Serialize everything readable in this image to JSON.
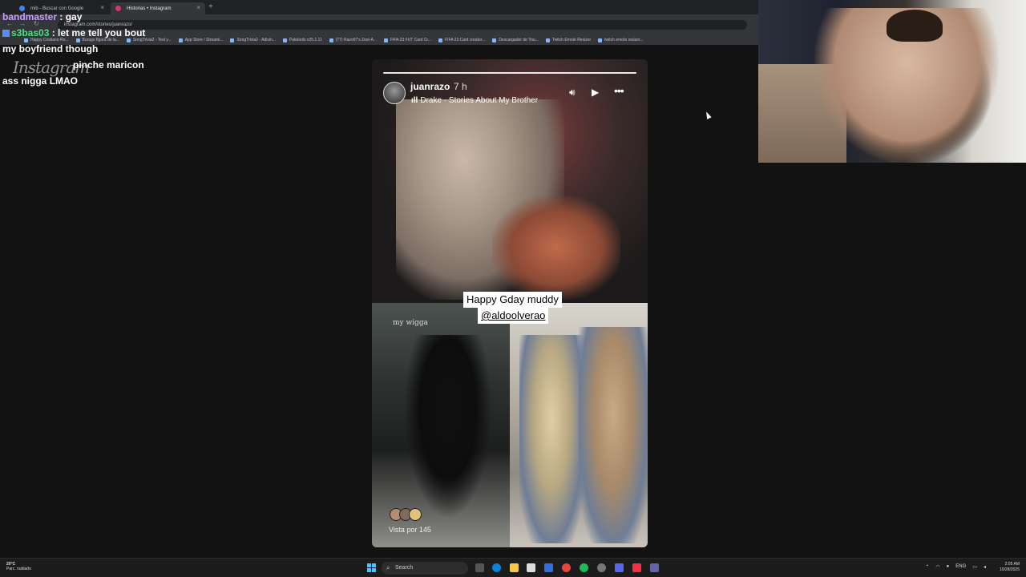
{
  "browser": {
    "tabs": [
      {
        "label": "mib - Buscar con Google"
      },
      {
        "label": "Historias • Instagram"
      }
    ],
    "url": "instagram.com/stories/juanrazo/",
    "bookmarks": [
      "Happy Cristiano Ro...",
      "Burago figura de la...",
      "SongTrivia2 - Test y...",
      "App Store / Streami...",
      "SongTrivia2 - Adivin...",
      "Paletools v25.1.11",
      "(77) Razo97's Zest-A...",
      "FIFA 23 FUT Card Cr...",
      "FIFA 23 Card creator...",
      "Descargador de You...",
      "Twitch Emote Resizer",
      "twitch emote resizer..."
    ]
  },
  "chat": {
    "messages": [
      {
        "user": "bandmaster",
        "sep": " : ",
        "text": "gay"
      },
      {
        "user": "s3bas03",
        "sep": " : ",
        "text": "let me tell you bout"
      },
      {
        "user": "",
        "sep": "",
        "text": "my boyfriend though"
      },
      {
        "user": "",
        "sep": "",
        "text": "pinche maricon"
      },
      {
        "user": "",
        "sep": "",
        "text": "ass nigga LMAO"
      }
    ]
  },
  "instagram": {
    "logo": "Instagram",
    "story": {
      "username": "juanrazo",
      "time_ago": "7 h",
      "music": "Drake · Stories About My Brother",
      "caption_line1": "Happy Gday muddy",
      "caption_line2": "@aldoolverao",
      "overlay_text": "my wigga",
      "views": "Vista por 145",
      "progress": 1.0
    }
  },
  "taskbar": {
    "weather_temp": "20°C",
    "weather_desc": "Parc. nublado",
    "search_placeholder": "Search",
    "language": "ENG",
    "time": "2:05 AM",
    "date": "10/28/2025"
  }
}
